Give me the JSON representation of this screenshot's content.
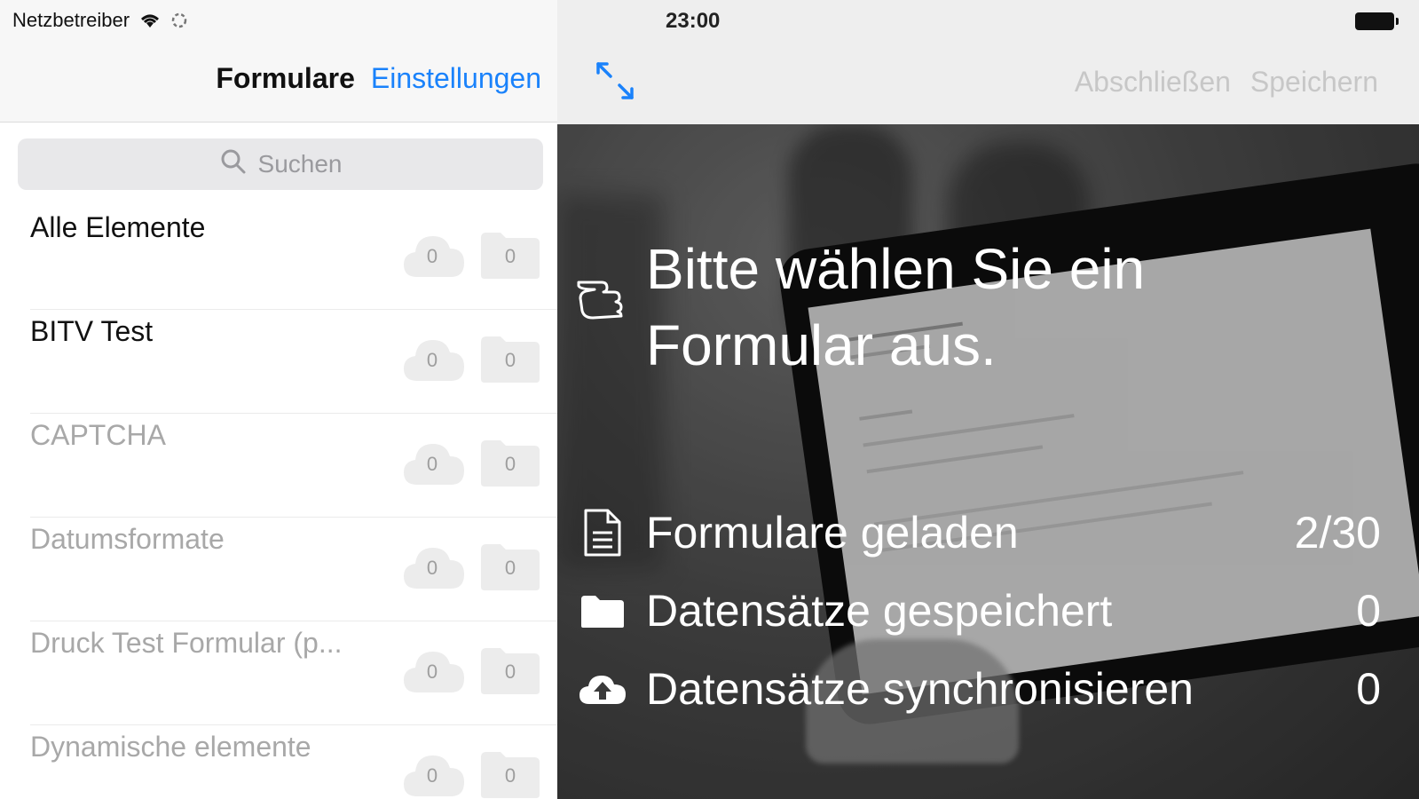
{
  "status_bar": {
    "carrier": "Netzbetreiber",
    "time": "23:00"
  },
  "sidebar": {
    "title": "Formulare",
    "settings_link": "Einstellungen",
    "search_placeholder": "Suchen",
    "items": [
      {
        "label": "Alle Elemente",
        "cloud_count": "0",
        "folder_count": "0",
        "state": "active"
      },
      {
        "label": "BITV Test",
        "cloud_count": "0",
        "folder_count": "0",
        "state": "active"
      },
      {
        "label": "CAPTCHA",
        "cloud_count": "0",
        "folder_count": "0",
        "state": "disabled"
      },
      {
        "label": "Datumsformate",
        "cloud_count": "0",
        "folder_count": "0",
        "state": "disabled"
      },
      {
        "label": "Druck Test Formular (p...",
        "cloud_count": "0",
        "folder_count": "0",
        "state": "disabled"
      },
      {
        "label": "Dynamische elemente",
        "cloud_count": "0",
        "folder_count": "0",
        "state": "disabled"
      }
    ]
  },
  "detail": {
    "finish_label": "Abschließen",
    "save_label": "Speichern",
    "prompt": "Bitte wählen Sie ein Formular aus.",
    "stats": [
      {
        "icon": "document-icon",
        "label": "Formulare geladen",
        "value": "2/30"
      },
      {
        "icon": "folder-icon",
        "label": "Datensätze gespeichert",
        "value": "0"
      },
      {
        "icon": "cloud-upload-icon",
        "label": "Datensätze synchronisieren",
        "value": "0"
      }
    ]
  },
  "colors": {
    "accent": "#1a82fb",
    "disabled_text": "#a8a8a8",
    "toolbar_disabled": "#c7c7c7"
  }
}
